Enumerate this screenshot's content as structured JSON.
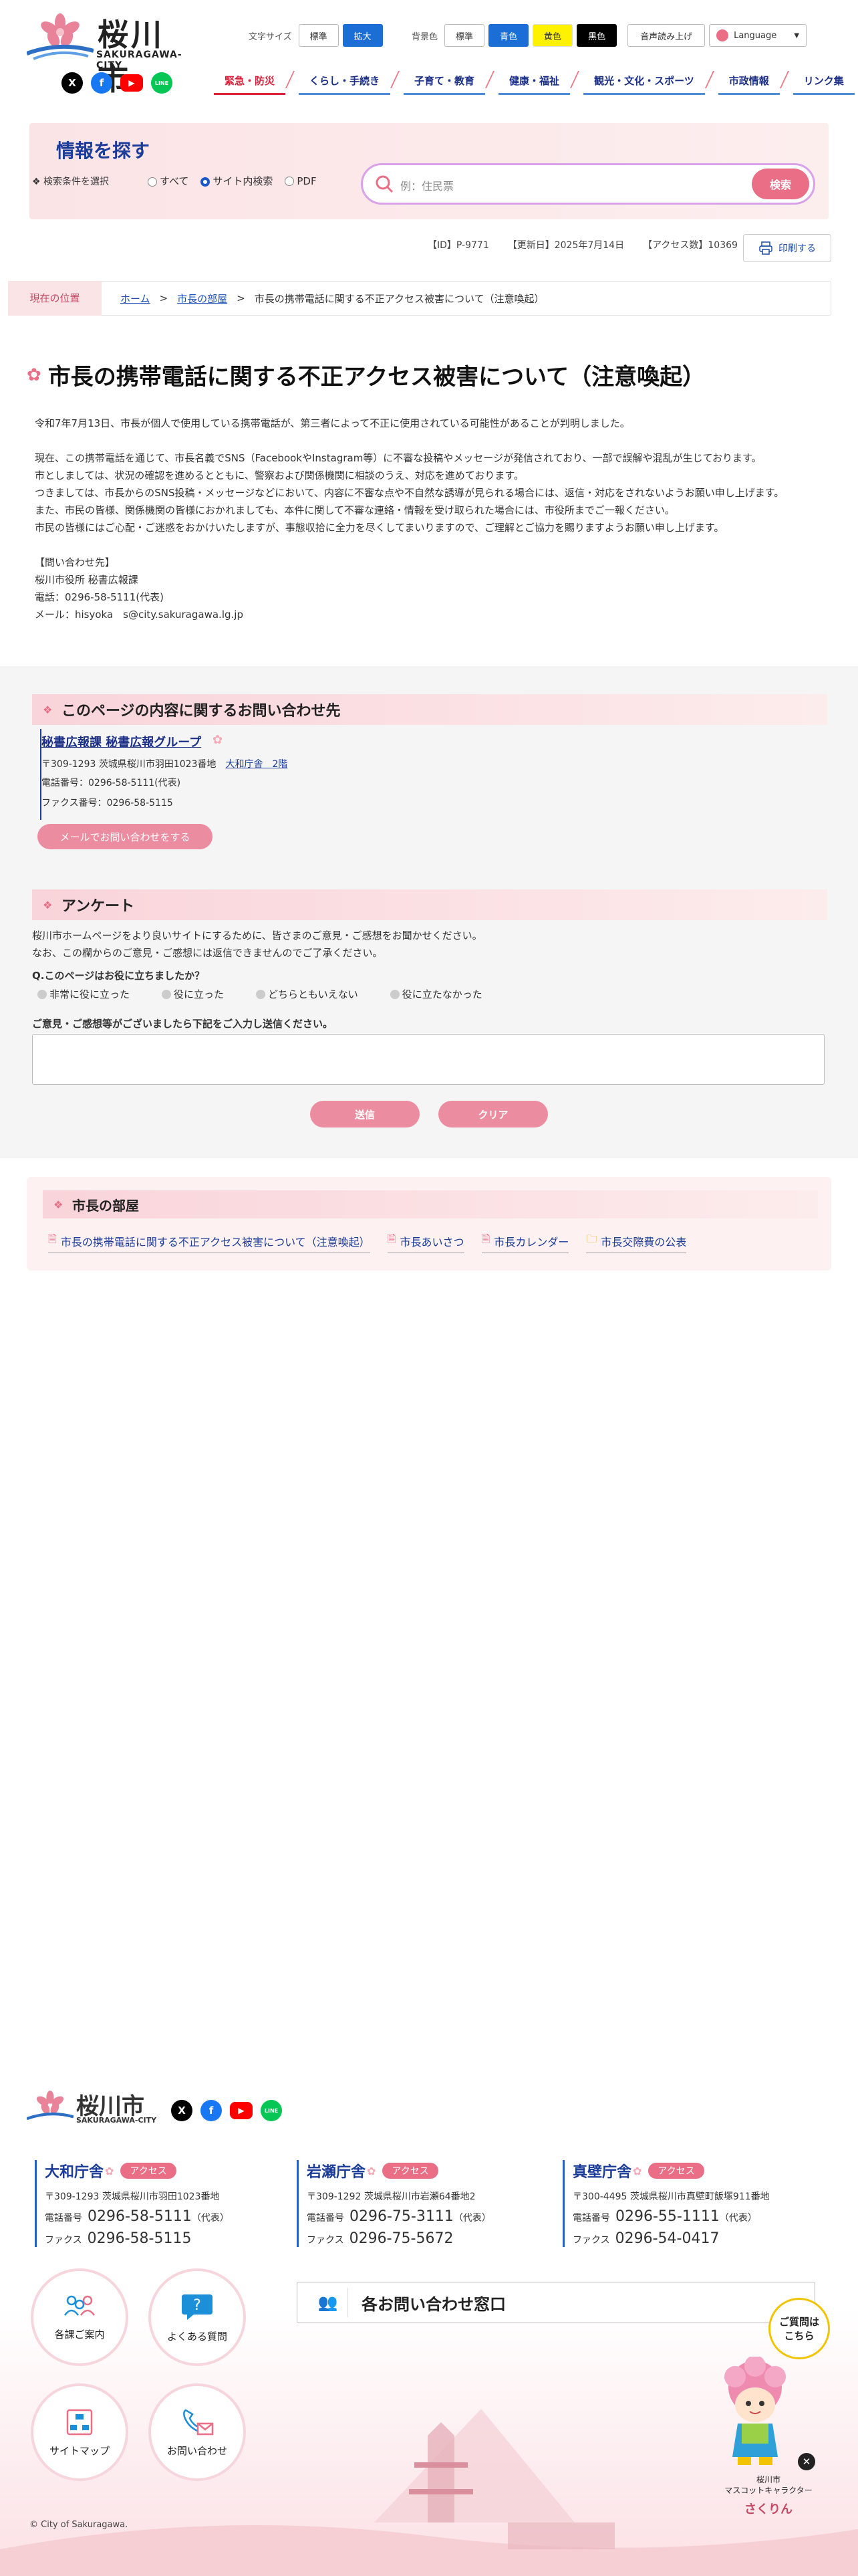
{
  "header": {
    "logo": {
      "name": "桜川市",
      "sub": "SAKURAGAWA-CITY"
    },
    "sns": [
      {
        "icon": "x-icon",
        "label": "X",
        "color": "#000000"
      },
      {
        "icon": "facebook-icon",
        "label": "f",
        "color": "#1877f2"
      },
      {
        "icon": "youtube-icon",
        "label": "▶",
        "color": "#ff0000"
      },
      {
        "icon": "line-icon",
        "label": "LINE",
        "color": "#06c755"
      }
    ],
    "font_size_label": "文字サイズ",
    "font_size_options": [
      "標準",
      "拡大"
    ],
    "bg_label": "背景色",
    "bg_options": [
      "標準",
      "青色",
      "黄色",
      "黒色"
    ],
    "tts": "音声読み上げ",
    "language": "Language"
  },
  "nav": [
    "緊急・防災",
    "くらし・手続き",
    "子育て・教育",
    "健康・福祉",
    "観光・文化・スポーツ",
    "市政情報",
    "リンク集"
  ],
  "search": {
    "title": "情報を探す",
    "condition": "検索条件を選択",
    "options": [
      "すべて",
      "サイト内検索",
      "PDF"
    ],
    "placeholder": "例：住民票",
    "button": "検索"
  },
  "page_meta": {
    "id": "【ID】P-9771",
    "updated": "【更新日】2025年7月14日",
    "access": "【アクセス数】10369",
    "print": "印刷する"
  },
  "breadcrumb": {
    "label": "現在の位置",
    "items": [
      "ホーム",
      "市長の部屋",
      "市長の携帯電話に関する不正アクセス被害について（注意喚起）"
    ]
  },
  "article": {
    "title": "市長の携帯電話に関する不正アクセス被害について（注意喚起）",
    "p1": "令和7年7月13日、市長が個人で使用している携帯電話が、第三者によって不正に使用されている可能性があることが判明しました。",
    "p2": "現在、この携帯電話を通じて、市長名義でSNS（FacebookやInstagram等）に不審な投稿やメッセージが発信されており、一部で誤解や混乱が生じております。\n市としましては、状況の確認を進めるとともに、警察および関係機関に相談のうえ、対応を進めております。\nつきましては、市長からのSNS投稿・メッセージなどにおいて、内容に不審な点や不自然な誘導が見られる場合には、返信・対応をされないようお願い申し上げます。\nまた、市民の皆様、関係機関の皆様におかれましても、本件に関して不審な連絡・情報を受け取られた場合には、市役所までご一報ください。\n市民の皆様にはご心配・ご迷惑をおかけいたしますが、事態収拾に全力を尽くしてまいりますので、ご理解とご協力を賜りますようお願い申し上げます。",
    "p3": "【問い合わせ先】\n桜川市役所 秘書広報課\n電話：0296-58-5111(代表)\nメール：hisyoka　s@city.sakuragawa.lg.jp"
  },
  "contact": {
    "heading": "このページの内容に関するお問い合わせ先",
    "org": "秘書広報課 秘書広報グループ",
    "address": "〒309-1293 茨城県桜川市羽田1023番地",
    "building": "大和庁舎　2階",
    "tel": "電話番号：0296-58-5111(代表)",
    "fax": "ファクス番号：0296-58-5115",
    "mail_button": "メールでお問い合わせをする"
  },
  "survey": {
    "heading": "アンケート",
    "intro1": "桜川市ホームページをより良いサイトにするために、皆さまのご意見・ご感想をお聞かせください。",
    "intro2": "なお、この欄からのご意見・ご感想には返信できませんのでご了承ください。",
    "question": "Q.このページはお役に立ちましたか？",
    "options": [
      "非常に役に立った",
      "役に立った",
      "どちらともいえない",
      "役に立たなかった"
    ],
    "comment_label": "ご意見・ご感想等がございましたら下記をご入力し送信ください。",
    "submit": "送信",
    "clear": "クリア"
  },
  "mayor_room": {
    "heading": "市長の部屋",
    "links": [
      "市長の携帯電話に関する不正アクセス被害について（注意喚起）",
      "市長あいさつ",
      "市長カレンダー",
      "市長交際費の公表"
    ]
  },
  "footer": {
    "offices": [
      {
        "name": "大和庁舎",
        "access": "アクセス",
        "address": "〒309-1293 茨城県桜川市羽田1023番地",
        "tel_label": "電話番号",
        "tel": "0296-58-5111",
        "tel_note": "（代表）",
        "fax_label": "ファクス",
        "fax": "0296-58-5115"
      },
      {
        "name": "岩瀬庁舎",
        "access": "アクセス",
        "address": "〒309-1292 茨城県桜川市岩瀬64番地2",
        "tel_label": "電話番号",
        "tel": "0296-75-3111",
        "tel_note": "（代表）",
        "fax_label": "ファクス",
        "fax": "0296-75-5672"
      },
      {
        "name": "真壁庁舎",
        "access": "アクセス",
        "address": "〒300-4495 茨城県桜川市真壁町飯塚911番地",
        "tel_label": "電話番号",
        "tel": "0296-55-1111",
        "tel_note": "（代表）",
        "fax_label": "ファクス",
        "fax": "0296-54-0417"
      }
    ],
    "circles": [
      "各課ご案内",
      "よくある質問",
      "サイトマップ",
      "お問い合わせ"
    ],
    "inquiry": "各お問い合わせ窓口",
    "mascot_bubble": "ご質問は\nこちら",
    "mascot_caption1": "桜川市\nマスコットキャラクター",
    "mascot_name": "さくりん",
    "copyright": "© City of Sakuragawa."
  }
}
